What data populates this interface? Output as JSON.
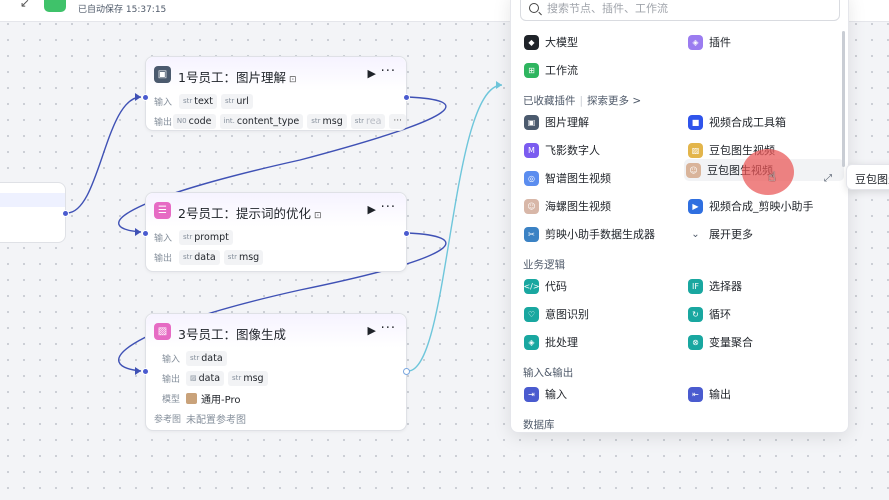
{
  "topbar": {
    "save_status": "已自动保存 15:37:15"
  },
  "nodes": {
    "n1": {
      "title": "1号员工：图片理解",
      "input_label": "输入",
      "output_label": "输出",
      "inputs": [
        {
          "type": "str",
          "name": "text"
        },
        {
          "type": "str",
          "name": "url"
        }
      ],
      "outputs": [
        {
          "type": "N0",
          "name": "code"
        },
        {
          "type": "int.",
          "name": "content_type"
        },
        {
          "type": "str",
          "name": "msg"
        },
        {
          "type": "str",
          "name": "rea"
        }
      ],
      "more_outputs": "···"
    },
    "n2": {
      "title": "2号员工：提示词的优化",
      "input_label": "输入",
      "output_label": "输出",
      "inputs": [
        {
          "type": "str",
          "name": "prompt"
        }
      ],
      "outputs": [
        {
          "type": "str",
          "name": "data"
        },
        {
          "type": "str",
          "name": "msg"
        }
      ]
    },
    "n3": {
      "title": "3号员工：图像生成",
      "input_label": "输入",
      "output_label": "输出",
      "model_label": "模型",
      "ref_label": "参考图",
      "inputs": [
        {
          "type": "str",
          "name": "data"
        }
      ],
      "outputs": [
        {
          "type": "img",
          "name": "data"
        },
        {
          "type": "str",
          "name": "msg"
        }
      ],
      "model": "通用-Pro",
      "ref_value": "未配置参考图"
    }
  },
  "panel": {
    "search_placeholder": "搜索节点、插件、工作流",
    "top_items": [
      "大模型",
      "插件",
      "工作流"
    ],
    "plugins_section": "已收藏插件",
    "explore_more": "探索更多 >",
    "plugins": [
      "图片理解",
      "视频合成工具箱",
      "飞影数字人",
      "豆包图生视频",
      "智谱图生视频",
      "豆包图生视频",
      "海螺图生视频",
      "视频合成_剪映小助手",
      "剪映小助手数据生成器",
      "展开更多"
    ],
    "logic_section": "业务逻辑",
    "logic": [
      "代码",
      "选择器",
      "意图识别",
      "循环",
      "批处理",
      "变量聚合"
    ],
    "io_section": "输入&输出",
    "io": [
      "输入",
      "输出"
    ],
    "db_section": "数据库",
    "colors": {
      "accent": "#4a5bcf",
      "highlight": "#e95454"
    }
  },
  "tooltip": {
    "text": "豆包图生视频"
  }
}
